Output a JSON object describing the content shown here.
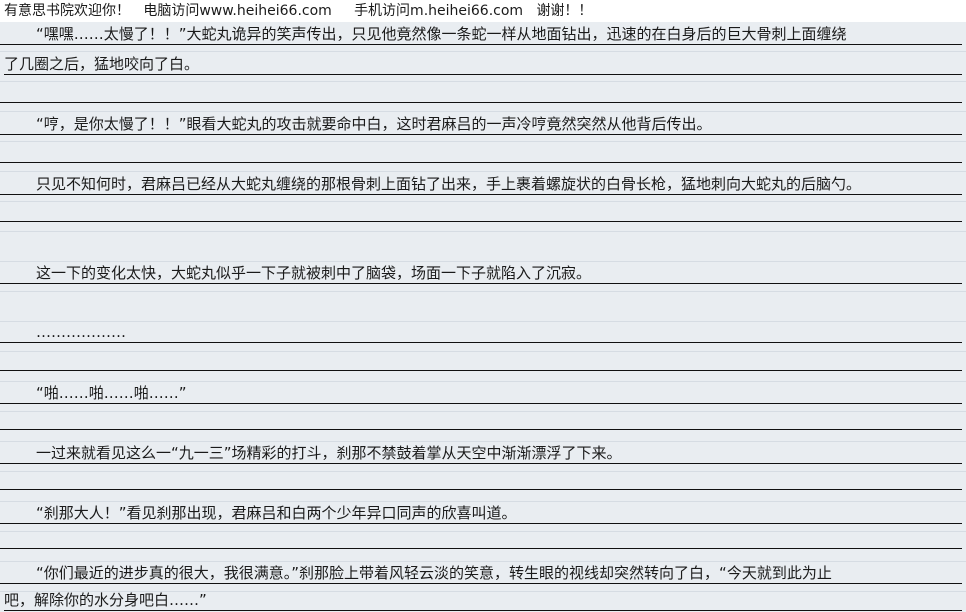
{
  "header": {
    "site_name": "有意思书院欢迎你！",
    "pc_label": "电脑访问www.heihei66.com",
    "mobile_label": "手机访问m.heihei66.com",
    "thanks": "谢谢！！"
  },
  "lines": [
    "“嘿嘿……太慢了！！”大蛇丸诡异的笑声传出，只见他竟然像一条蛇一样从地面钻出，迅速的在白身后的巨大骨刺上面缠绕",
    "了几圈之后，猛地咬向了白。",
    "“哼，是你太慢了！！”眼看大蛇丸的攻击就要命中白，这时君麻吕的一声冷哼竟然突然从他背后传出。",
    "只见不知何时，君麻吕已经从大蛇丸缠绕的那根骨刺上面钻了出来，手上裹着螺旋状的白骨长枪，猛地刺向大蛇丸的后脑勺。",
    "这一下的变化太快，大蛇丸似乎一下子就被刺中了脑袋，场面一下子就陷入了沉寂。",
    "………………",
    "“啪……啪……啪……”",
    "一过来就看见这么一“九一三”场精彩的打斗，刹那不禁鼓着掌从天空中渐渐漂浮了下来。",
    "“刹那大人！”看见刹那出现，君麻吕和白两个少年异口同声的欣喜叫道。",
    "“你们最近的进步真的很大，我很满意。”刹那脸上带着风轻云淡的笑意，转生眼的视线却突然转向了白，“今天就到此为止",
    "吧，解除你的水分身吧白……”"
  ]
}
